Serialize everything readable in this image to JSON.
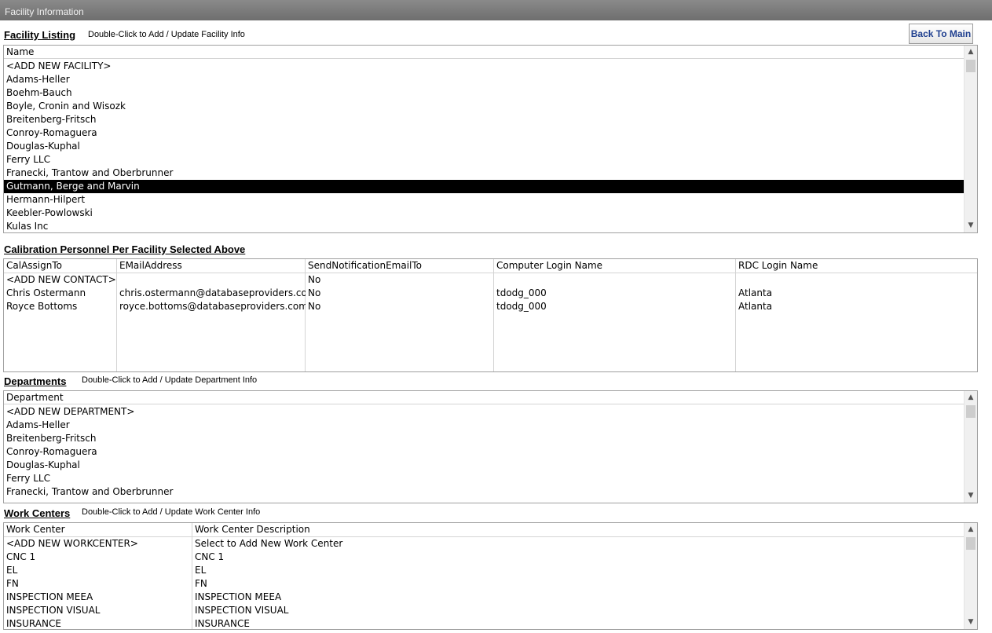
{
  "window": {
    "title": "Facility Information"
  },
  "back_button": {
    "label": "Back To Main"
  },
  "facility": {
    "title": "Facility Listing",
    "hint": "Double-Click to Add / Update Facility Info",
    "header": "Name",
    "rows": [
      "<ADD NEW FACILITY>",
      "Adams-Heller",
      "Boehm-Bauch",
      "Boyle, Cronin and Wisozk",
      "Breitenberg-Fritsch",
      "Conroy-Romaguera",
      "Douglas-Kuphal",
      "Ferry LLC",
      "Franecki, Trantow and Oberbrunner",
      "Gutmann, Berge and Marvin",
      "Hermann-Hilpert",
      "Keebler-Powlowski",
      "Kulas Inc"
    ],
    "selected": "Gutmann, Berge and Marvin"
  },
  "personnel": {
    "title": "Calibration Personnel Per Facility Selected Above",
    "columns": [
      "CalAssignTo",
      "EMailAddress",
      "SendNotificationEmailTo",
      "Computer Login Name",
      "RDC Login Name"
    ],
    "rows": [
      [
        "<ADD NEW CONTACT>",
        "",
        "No",
        "",
        ""
      ],
      [
        "Chris Ostermann",
        "chris.ostermann@databaseproviders.com",
        "No",
        "tdodg_000",
        "Atlanta"
      ],
      [
        "Royce Bottoms",
        "royce.bottoms@databaseproviders.com",
        "No",
        "tdodg_000",
        "Atlanta"
      ]
    ]
  },
  "departments": {
    "title": "Departments",
    "hint": "Double-Click to Add / Update Department Info",
    "header": "Department",
    "rows": [
      "<ADD NEW DEPARTMENT>",
      "Adams-Heller",
      "Breitenberg-Fritsch",
      "Conroy-Romaguera",
      "Douglas-Kuphal",
      "Ferry LLC",
      "Franecki, Trantow and Oberbrunner"
    ]
  },
  "workcenters": {
    "title": "Work Centers",
    "hint": "Double-Click to Add / Update Work Center Info",
    "columns": [
      "Work Center",
      "Work Center Description"
    ],
    "rows": [
      [
        "<ADD NEW WORKCENTER>",
        "Select to Add New Work Center"
      ],
      [
        "CNC 1",
        "CNC 1"
      ],
      [
        "EL",
        "EL"
      ],
      [
        "FN",
        "FN"
      ],
      [
        "INSPECTION MEEA",
        "INSPECTION MEEA"
      ],
      [
        "INSPECTION VISUAL",
        "INSPECTION VISUAL"
      ],
      [
        "INSURANCE",
        "INSURANCE"
      ]
    ]
  },
  "icons": {
    "scroll_up": "chevron-up-icon",
    "scroll_down": "chevron-down-icon"
  }
}
